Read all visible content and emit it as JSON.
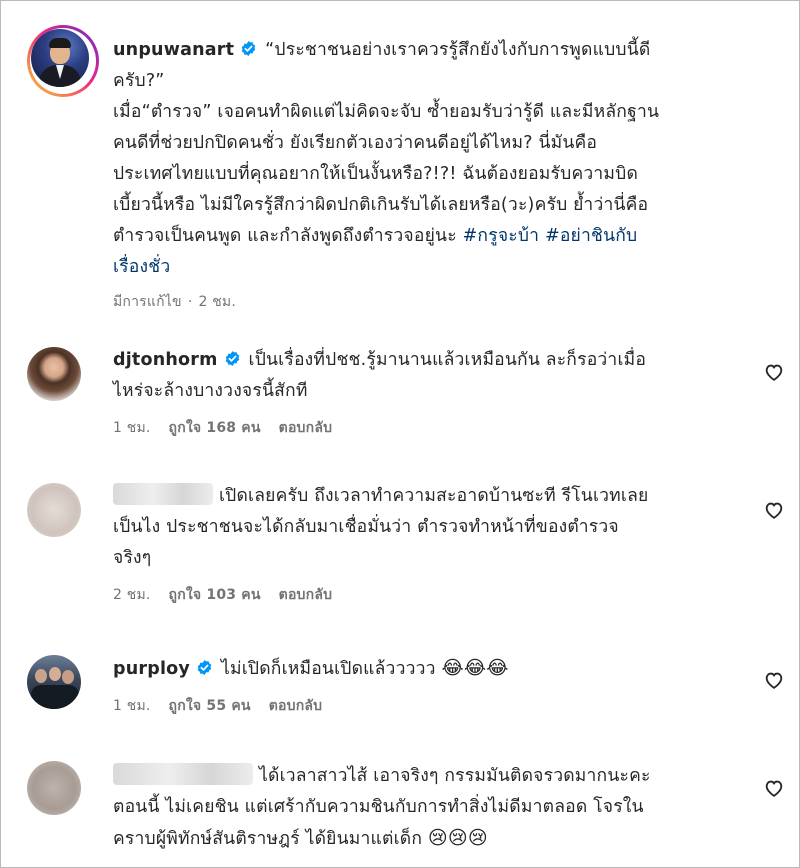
{
  "post": {
    "username": "unpuwanart",
    "caption_part1": "“ประชาชนอย่างเราควรรู้สึกยังไงกับการพูดแบบนี้ดี\nครับ?”\nเมื่อ“ตำรวจ” เจอคนทำผิดแต่ไม่คิดจะจับ ซ้ำยอมรับว่ารู้ดี และมีหลักฐาน\nคนดีที่ช่วยปกปิดคนชั่ว ยังเรียกตัวเองว่าคนดีอยู่ได้ไหม? นี่มันคือ\nประเทศไทยแบบที่คุณอยากให้เป็นงั้นหรือ?!?! ฉันต้องยอมรับความบิด\nเบี้ยวนี้หรือ ไม่มีใครรู้สึกว่าผิดปกติเกินรับได้เลยหรือ(วะ)ครับ ย้ำว่านี่คือ\nตำรวจเป็นคนพูด และกำลังพูดถึงตำรวจอยู่นะ ",
    "hashtags": "#กรูจะบ้า #อย่าชินกับ\nเรื่องชั่ว",
    "edited_label": "มีการแก้ไข",
    "separator": "·",
    "time": "2 ชม."
  },
  "comments": [
    {
      "username": "djtonhorm",
      "text": "เป็นเรื่องที่ปชช.รู้มานานแล้วเหมือนกัน ละก็รอว่าเมื่อ\nไหร่จะล้างบางวงจรนี้สักที",
      "time": "1 ชม.",
      "likes": "ถูกใจ 168 คน",
      "reply": "ตอบกลับ"
    },
    {
      "username": "",
      "text": "เปิดเลยครับ ถึงเวลาทำความสะอาดบ้านซะที รีโนเวทเลย\nเป็นไง ประชาชนจะได้กลับมาเชื่อมั่นว่า ตำรวจทำหน้าที่ของตำรวจ\nจริงๆ",
      "time": "2 ชม.",
      "likes": "ถูกใจ 103 คน",
      "reply": "ตอบกลับ"
    },
    {
      "username": "purploy",
      "text": "ไม่เปิดก็เหมือนเปิดแล้ววววว",
      "emoji": "😂😂😂",
      "time": "1 ชม.",
      "likes": "ถูกใจ 55 คน",
      "reply": "ตอบกลับ"
    },
    {
      "username": "",
      "text": "ได้เวลาสาวไส้ เอาจริงๆ กรรมมันติดจรวดมากนะคะ\nตอนนี้ ไม่เคยชิน แต่เศร้ากับความชินกับการทำสิ่งไม่ดีมาตลอด โจรใน\nคราบผู้พิทักษ์สันติราษฎร์ ได้ยินมาแต่เด็ก",
      "emoji": "😢😢😢"
    }
  ],
  "colors": {
    "text": "#262626",
    "meta": "#737373",
    "hashtag": "#00376b",
    "verified": "#0095f6"
  },
  "icons": {
    "verified": "verified-badge-icon",
    "heart": "heart-outline-icon"
  }
}
